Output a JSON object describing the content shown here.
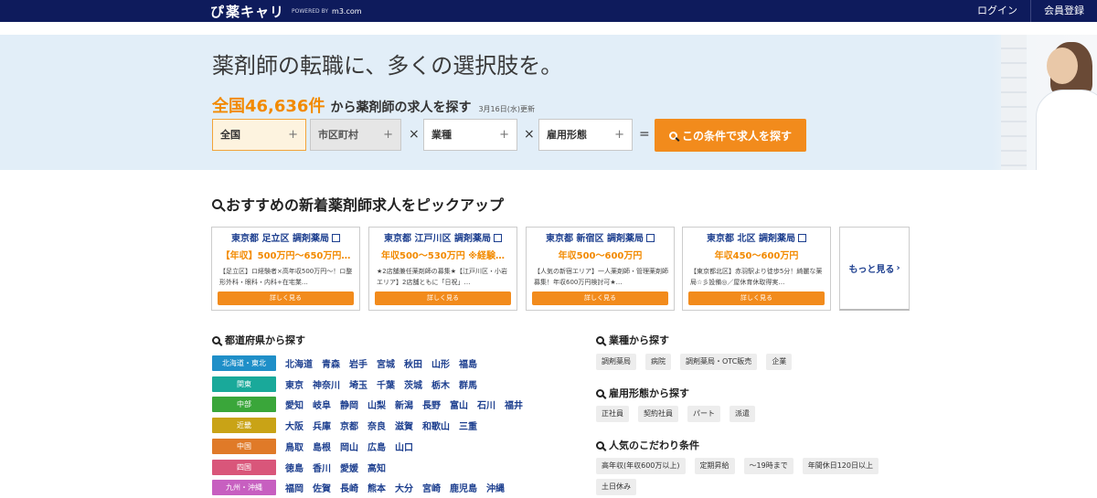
{
  "brand": {
    "mark": "ぴ",
    "name": "薬キャリ",
    "powered": "POWERED BY",
    "m3": "m3.com"
  },
  "header": {
    "login": "ログイン",
    "register": "会員登録"
  },
  "hero": {
    "title": "薬剤師の転職に、多くの選択肢を。",
    "total": "全国46,636件",
    "suffix": "から薬剤師の求人を探す",
    "updated": "3月16日(水)更新",
    "selects": {
      "area": "全国",
      "city": "市区町村",
      "industry": "業種",
      "employment": "雇用形態"
    },
    "ops": {
      "times1": "×",
      "times2": "×",
      "equals": "="
    },
    "search_button": "この条件で求人を探す"
  },
  "pickup": {
    "title": "おすすめの新着薬剤師求人をピックアップ",
    "cards": [
      {
        "title": "東京都 足立区 調剤薬局",
        "salary": "【年収】500万円～650万円…",
        "desc": "【足立区】ロ経験者×高年収500万円～！ロ整形外科・眼科・内科+在宅業…",
        "button": "詳しく見る"
      },
      {
        "title": "東京都 江戸川区 調剤薬局",
        "salary": "年収500～530万円 ※経験…",
        "desc": "★2店舗兼任薬剤師の募集★【江戸川区・小岩エリア】2店舗ともに「日祝」…",
        "button": "詳しく見る"
      },
      {
        "title": "東京都 新宿区 調剤薬局",
        "salary": "年収500～600万円",
        "desc": "【人気の新宿エリア】一人薬剤師・管理薬剤師募集！年収600万円検討可★…",
        "button": "詳しく見る"
      },
      {
        "title": "東京都 北区 調剤薬局",
        "salary": "年収450～600万円",
        "desc": "【東京都北区】赤羽駅より徒歩5分！綺麗な薬局☆彡設備◎／屋休育休取得実…",
        "button": "詳しく見る"
      }
    ],
    "more": "もっと見る"
  },
  "prefectures": {
    "title": "都道府県から探す",
    "regions": [
      {
        "name": "北海道・東北",
        "color": "#1f8fc8",
        "prefs": [
          "北海道",
          "青森",
          "岩手",
          "宮城",
          "秋田",
          "山形",
          "福島"
        ]
      },
      {
        "name": "関東",
        "color": "#19a99a",
        "prefs": [
          "東京",
          "神奈川",
          "埼玉",
          "千葉",
          "茨城",
          "栃木",
          "群馬"
        ]
      },
      {
        "name": "中部",
        "color": "#3aa63a",
        "prefs": [
          "愛知",
          "岐阜",
          "静岡",
          "山梨",
          "新潟",
          "長野",
          "富山",
          "石川",
          "福井"
        ]
      },
      {
        "name": "近畿",
        "color": "#c9a316",
        "prefs": [
          "大阪",
          "兵庫",
          "京都",
          "奈良",
          "滋賀",
          "和歌山",
          "三重"
        ]
      },
      {
        "name": "中国",
        "color": "#e07a28",
        "prefs": [
          "鳥取",
          "島根",
          "岡山",
          "広島",
          "山口"
        ]
      },
      {
        "name": "四国",
        "color": "#d9567a",
        "prefs": [
          "徳島",
          "香川",
          "愛媛",
          "高知"
        ]
      },
      {
        "name": "九州・沖縄",
        "color": "#c75fc0",
        "prefs": [
          "福岡",
          "佐賀",
          "長崎",
          "熊本",
          "大分",
          "宮崎",
          "鹿児島",
          "沖縄"
        ]
      }
    ]
  },
  "industry": {
    "title": "業種から探す",
    "tags": [
      "調剤薬局",
      "病院",
      "調剤薬局・OTC販売",
      "企業"
    ]
  },
  "employment": {
    "title": "雇用形態から探す",
    "tags": [
      "正社員",
      "契約社員",
      "パート",
      "派遣"
    ]
  },
  "popular": {
    "title": "人気のこだわり条件",
    "tags": [
      "高年収(年収600万以上)",
      "定期昇給",
      "～19時まで",
      "年間休日120日以上",
      "土日休み"
    ]
  }
}
